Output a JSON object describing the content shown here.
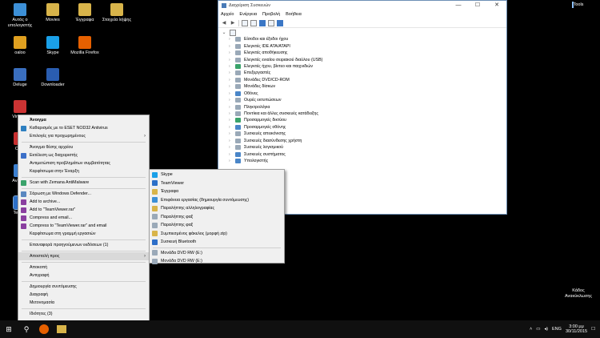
{
  "desktop_icons": [
    {
      "id": "computer",
      "label": "Αυτός ο υπολογιστής",
      "color": "#3c8fd6"
    },
    {
      "id": "movies",
      "label": "Movies",
      "color": "#d8b44a"
    },
    {
      "id": "docs",
      "label": "Έγγραφα",
      "color": "#d8b44a"
    },
    {
      "id": "elements",
      "label": "Στοιχεία λήψης",
      "color": "#d8b44a"
    },
    {
      "id": "valoo",
      "label": "oaloo",
      "color": "#e0a020"
    },
    {
      "id": "skype",
      "label": "Skype",
      "color": "#1aa0e8"
    },
    {
      "id": "firefox",
      "label": "Mozilla Firefox",
      "color": "#e66000"
    },
    {
      "id": "deluge",
      "label": "Deluge",
      "color": "#3a6fc0"
    },
    {
      "id": "downloader",
      "label": "Downloader",
      "color": "#2a5db0"
    },
    {
      "id": "vir",
      "label": "Vir Clon",
      "color": "#cc3333"
    },
    {
      "id": "ccleaner",
      "label": "CCle",
      "color": "#c83030"
    },
    {
      "id": "avast",
      "label": "Ava Ultr",
      "color": "#3c80d0"
    },
    {
      "id": "teamviewer",
      "label": "TeamV",
      "color": "#2d70c8"
    }
  ],
  "tools_label": "Tools",
  "trash_label": "Κάδος Ανακύκλωσης",
  "device_manager": {
    "title": "Διαχείριση Συσκευών",
    "controls": [
      "—",
      "☐",
      "✕"
    ],
    "menu": [
      "Αρχείο",
      "Ενέργεια",
      "Προβολή",
      "Βοήθεια"
    ],
    "root": "",
    "items": [
      "Είσοδοι και έξοδοι ήχου",
      "Ελεγκτές IDE ATA/ATAPI",
      "Ελεγκτές αποθήκευσης",
      "Ελεγκτές ενιαίου σειριακού διαύλου (USB)",
      "Ελεγκτές ήχου, βίντεο και παιχνιδιών",
      "Επεξεργαστές",
      "Μονάδες DVD/CD-ROM",
      "Μονάδες δίσκων",
      "Οθόνες",
      "Ουρές εκτυπώσεων",
      "Πληκτρολόγια",
      "Ποντίκια και άλλες συσκευές κατάδειξης",
      "Προσαρμογείς δικτύου",
      "Προσαρμογείς οθόνης",
      "Συσκευές απεικόνισης",
      "Συσκευές διασύνδεσης χρήστη",
      "Συσκευές λογισμικού",
      "Συσκευές συστήματος",
      "Υπολογιστής"
    ]
  },
  "context_menu": {
    "items": [
      {
        "label": "Άνοιγμα",
        "bold": true
      },
      {
        "label": "Καθαρισμός με το ESET NOD32 Antivirus",
        "icon": "#2d7fc0"
      },
      {
        "label": "Επιλογές για προχωρημένους",
        "arrow": true
      },
      {
        "sep": true
      },
      {
        "label": "Άνοιγμα θέσης αρχείου"
      },
      {
        "label": "Εκτέλεση ως διαχειριστής",
        "icon": "#3c70c8"
      },
      {
        "label": "Αντιμετώπιση προβλημάτων συμβατότητας"
      },
      {
        "label": "Καρφίτσωμα στην Έναρξη"
      },
      {
        "sep": true
      },
      {
        "label": "Scan with Zemana AntiMalware",
        "icon": "#3aa36b"
      },
      {
        "sep": true
      },
      {
        "label": "Σάρωση με Windows Defender...",
        "icon": "#5a88c0"
      },
      {
        "label": "Add to archive...",
        "icon": "#8a3fa0"
      },
      {
        "label": "Add to \"TeamViewer.rar\"",
        "icon": "#8a3fa0"
      },
      {
        "label": "Compress and email...",
        "icon": "#8a3fa0"
      },
      {
        "label": "Compress to \"TeamViewer.rar\" and email",
        "icon": "#8a3fa0"
      },
      {
        "label": "Καρφίτσωμα στη γραμμή εργασιών"
      },
      {
        "sep": true
      },
      {
        "label": "Επαναφορά προηγούμενων εκδόσεων (1)"
      },
      {
        "sep": true
      },
      {
        "label": "Αποστολή προς",
        "arrow": true,
        "highlight": true
      },
      {
        "sep": true
      },
      {
        "label": "Αποκοπή"
      },
      {
        "label": "Αντιγραφή"
      },
      {
        "sep": true
      },
      {
        "label": "Δημιουργία συντόμευσης"
      },
      {
        "label": "Διαγραφή"
      },
      {
        "label": "Μετονομασία"
      },
      {
        "sep": true
      },
      {
        "label": "Ιδιότητες (3)"
      }
    ]
  },
  "send_to_menu": {
    "items": [
      {
        "label": "Skype",
        "icon": "#1aa0e8"
      },
      {
        "label": "TeamViewer",
        "icon": "#2d70c8"
      },
      {
        "label": "Έγγραφα",
        "icon": "#d8b44a"
      },
      {
        "label": "Επιφάνεια εργασίας (δημιουργία συντόμευσης)",
        "icon": "#3c8fd6"
      },
      {
        "label": "Παραλήπτης αλληλογραφίας",
        "icon": "#d8b44a"
      },
      {
        "label": "Παραλήπτης φαξ",
        "icon": "#9aa9b8"
      },
      {
        "label": "Παραλήπτης φαξ",
        "icon": "#9aa9b8"
      },
      {
        "label": "Συμπιεσμένος φάκελος (μορφή zip)",
        "icon": "#d8b44a"
      },
      {
        "label": "Συσκευή Bluetooth",
        "icon": "#2d6ec8"
      },
      {
        "sep": true
      },
      {
        "label": "Μονάδα DVD RW (E:)",
        "icon": "#9aa9b8"
      },
      {
        "label": "Μονάδα DVD RW (E:)",
        "icon": "#9aa9b8"
      }
    ]
  },
  "taskbar": {
    "start": "⊞",
    "search": "⚲",
    "lang": "ENG",
    "time": "3:00 μμ",
    "date": "30/11/2015"
  }
}
